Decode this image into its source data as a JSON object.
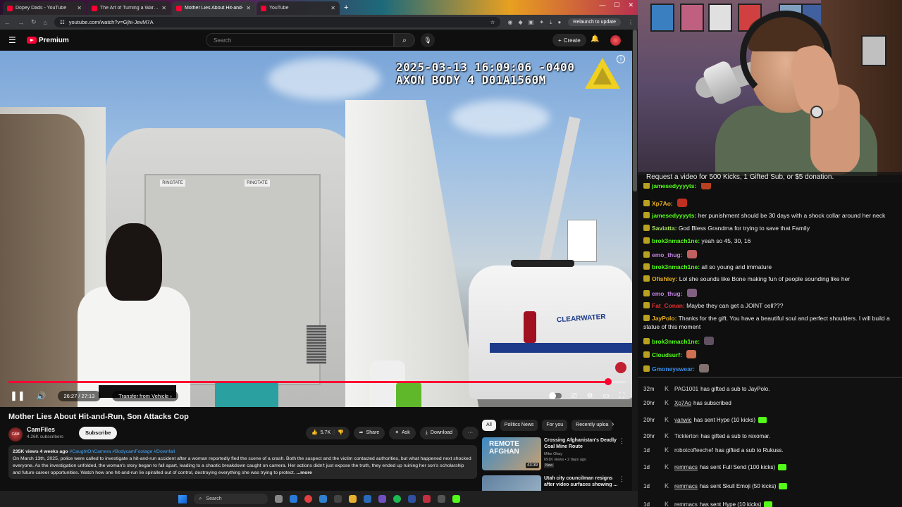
{
  "browser": {
    "tabs": [
      {
        "title": "Dopey Dads - YouTube",
        "active": false
      },
      {
        "title": "The Art of Turning a Warning I",
        "active": false
      },
      {
        "title": "Mother Lies About Hit-and-",
        "active": true
      },
      {
        "title": "YouTube",
        "active": false
      }
    ],
    "url": "youtube.com/watch?v=Gjhi-JevM7A",
    "relaunch_label": "Relaunch to update"
  },
  "youtube": {
    "logo": "Premium",
    "search_placeholder": "Search",
    "create_label": "Create",
    "video": {
      "overlay_line1": "2025-03-13 16:09:06 -0400",
      "overlay_line2": "AXON BODY 4 D01A1560M",
      "time_display": "26:27 / 27:13",
      "chapter": "Transfer from Vehicle",
      "progress_fraction": 0.972,
      "car_text": "CLEARWATER",
      "shelf_label": "RINGTATE"
    },
    "title": "Mother Lies About Hit-and-Run, Son Attacks Cop",
    "channel": {
      "avatar_text": "CAM",
      "name": "CamFiles",
      "subscribers": "4.26K subscribers",
      "subscribe_label": "Subscribe"
    },
    "actions": {
      "likes": "5.7K",
      "share": "Share",
      "ask": "Ask",
      "download": "Download"
    },
    "description": {
      "meta": "235K views  4 weeks ago ",
      "tags": "#CaughtOnCamera #BodycamFootage #Downfall",
      "body": "On March 13th, 2025, police were called to investigate a hit-and-run accident after a woman reportedly fled the scene of a crash. Both the suspect and the victim contacted authorities, but what happened next shocked everyone. As the investigation unfolded, the woman's story began to fall apart, leading to a chaotic breakdown caught on camera. Her actions didn't just expose the truth, they ended up ruining her son's scholarship and future career opportunities. Watch how one hit-and-run lie spiralled out of control, destroying everything she was trying to protect.",
      "more": " ...more"
    },
    "chips": [
      "All",
      "Politics News",
      "For you",
      "Recently uploa"
    ],
    "related": [
      {
        "title": "Crossing Afghanistan's Deadly Coal Mine Route",
        "channel": "Mike Okay",
        "views": "691K views • 2 days ago",
        "badge": "New",
        "duration": "43:39",
        "thumb_text": "REMOTE AFGHAN"
      },
      {
        "title": "Utah city councilman resigns after video surfaces showing ...",
        "channel": "",
        "views": "",
        "badge": "",
        "duration": "",
        "thumb_text": ""
      }
    ]
  },
  "taskbar": {
    "search_label": "Search"
  },
  "stream": {
    "banner": "Request a video for 500 Kicks, 1 Gifted Sub, or $5 donation.",
    "messages": [
      {
        "user": "jamesedyyyyts:",
        "text": "",
        "color": "#53fc18",
        "emote": "#b84020",
        "partial": true
      },
      {
        "user": "Xp7Ao:",
        "text": "",
        "color": "#e8b020",
        "emote": "#c03020"
      },
      {
        "user": "jamesedyyyyts:",
        "text": "her punishment should be 30 days with a shock collar around her neck",
        "color": "#53fc18",
        "emote": ""
      },
      {
        "user": "Saviatta:",
        "text": "God Bless Grandma for trying to save that Family",
        "color": "#a8e060",
        "emote": ""
      },
      {
        "user": "brok3nmach1ne:",
        "text": "yeah so 45, 30, 16",
        "color": "#53fc18",
        "emote": ""
      },
      {
        "user": "emo_thug:",
        "text": "",
        "color": "#c080e0",
        "emote": "#c06060"
      },
      {
        "user": "brok3nmach1ne:",
        "text": "all so young and immature",
        "color": "#53fc18",
        "emote": ""
      },
      {
        "user": "Ofishley:",
        "text": "Lol she sounds like Bone making fun of people sounding like her",
        "color": "#e8b020",
        "emote": ""
      },
      {
        "user": "emo_thug:",
        "text": "",
        "color": "#c080e0",
        "emote": "#806080"
      },
      {
        "user": "Fat_Conan:",
        "text": "Maybe they can get a JOINT cell???",
        "color": "#e03030",
        "emote": ""
      },
      {
        "user": "JayPolo:",
        "text": "Thanks for the gift. You have a beautiful soul and perfect shoulders. I will build a",
        "color": "#e8b020",
        "emote": ""
      },
      {
        "user": "",
        "text": "statue of this moment",
        "color": "#efeff1",
        "emote": ""
      },
      {
        "user": "brok3nmach1ne:",
        "text": "",
        "color": "#53fc18",
        "emote": "#605060"
      },
      {
        "user": "Cloudsurf:",
        "text": "",
        "color": "#53fc18",
        "emote": "#d07050"
      },
      {
        "user": "Gmoneyswear:",
        "text": "",
        "color": "#3a8ee8",
        "emote": "#807070"
      }
    ],
    "events": [
      {
        "time": "32m",
        "user": "PAG1001",
        "underline": false,
        "text": "has gifted a sub to JayPolo.",
        "kicks": false
      },
      {
        "time": "20hr",
        "user": "Xp7Ao",
        "underline": true,
        "text": "has subscribed",
        "kicks": false
      },
      {
        "time": "20hr",
        "user": "yanwic",
        "underline": true,
        "text": "has sent Hype (10 kicks)",
        "kicks": true
      },
      {
        "time": "20hr",
        "user": "Ticklerton",
        "underline": false,
        "text": "has gifted a sub to rexomar.",
        "kicks": false
      },
      {
        "time": "1d",
        "user": "robotcoffeechef",
        "underline": false,
        "text": "has gifted a sub to Rukuss.",
        "kicks": false
      },
      {
        "time": "1d",
        "user": "remmacs",
        "underline": true,
        "text": "has sent Full Send (100 kicks)",
        "kicks": true
      },
      {
        "time": "1d",
        "user": "remmacs",
        "underline": true,
        "text": "has sent Skull Emoji (50 kicks)",
        "kicks": true
      },
      {
        "time": "1d",
        "user": "remmacs",
        "underline": true,
        "text": "has sent Hype (10 kicks)",
        "kicks": true
      }
    ]
  },
  "colors": {
    "youtube_red": "#ff0033",
    "kick_green": "#53fc18",
    "link_blue": "#3ea6ff"
  }
}
